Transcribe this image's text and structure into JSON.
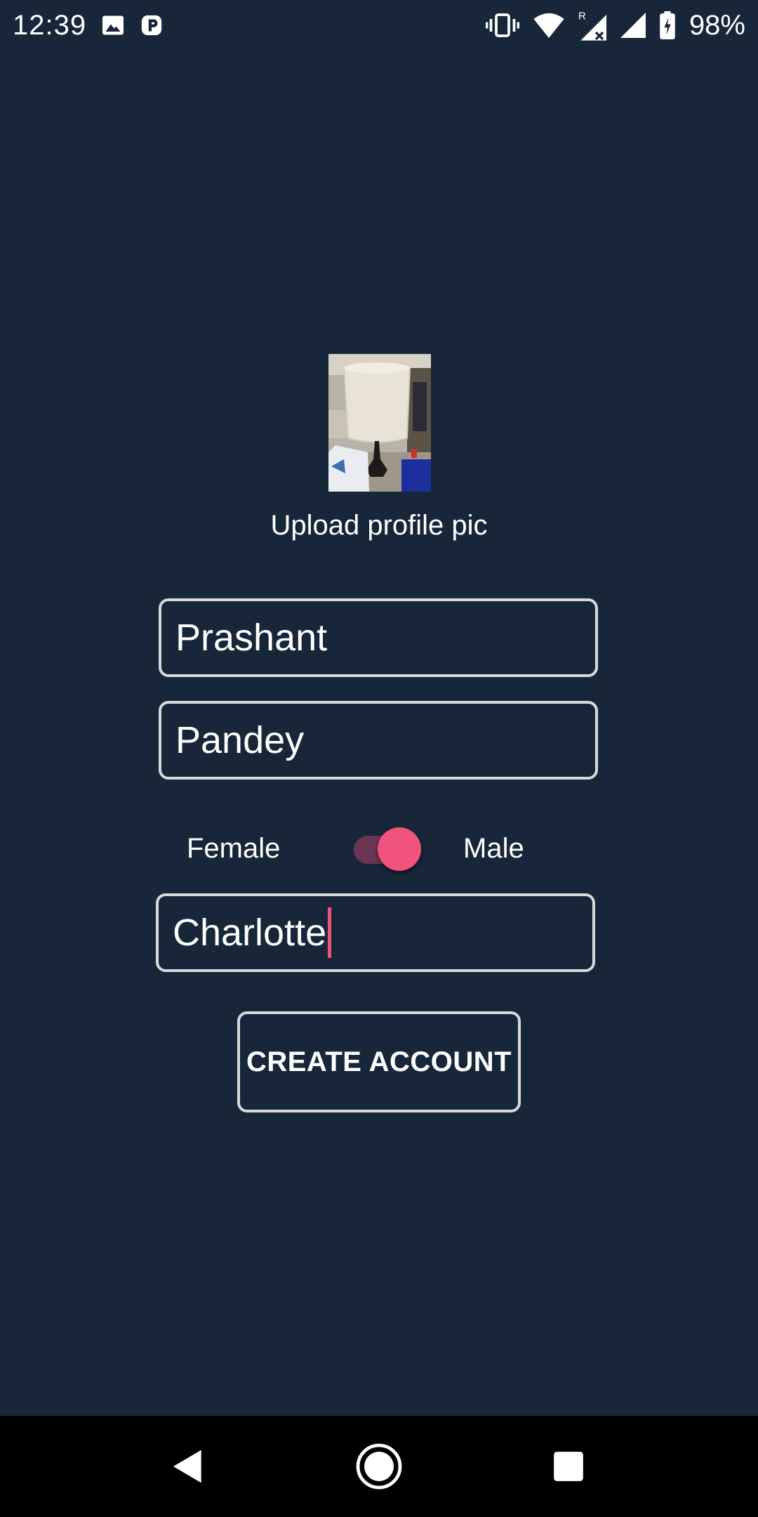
{
  "status_bar": {
    "time": "12:39",
    "battery_percent": "98%",
    "icons": [
      "image-icon",
      "parking-icon",
      "vibrate-icon",
      "wifi-icon",
      "signal-roaming-icon",
      "signal-icon",
      "battery-charging-icon"
    ]
  },
  "profile": {
    "upload_label": "Upload profile pic"
  },
  "form": {
    "first_name": "Prashant",
    "last_name": "Pandey",
    "gender_left_label": "Female",
    "gender_right_label": "Male",
    "gender_toggle_on": true,
    "city": "Charlotte",
    "create_button_label": "CREATE ACCOUNT"
  },
  "colors": {
    "background": "#172638",
    "accent": "#f0537b",
    "border": "#d9d9d9"
  },
  "nav_bar": {
    "icons": [
      "back-icon",
      "home-icon",
      "recents-icon"
    ]
  }
}
